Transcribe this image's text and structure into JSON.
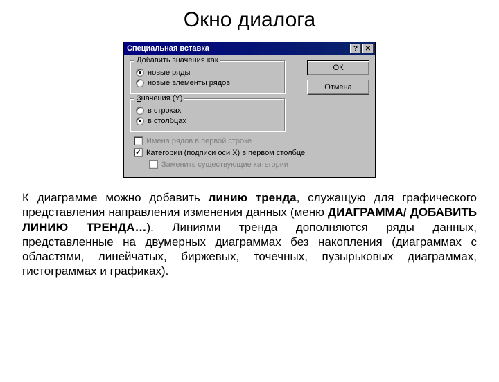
{
  "page": {
    "title": "Окно диалога"
  },
  "dialog": {
    "title": "Специальная вставка",
    "buttons": {
      "ok": "ОК",
      "cancel": "Отмена"
    },
    "group1": {
      "legend": "Добавить значения как",
      "opt1": "новые ряды",
      "opt2": "новые элементы рядов"
    },
    "group2": {
      "legend": "Значения (Y)",
      "opt1": "в строках",
      "opt2": "в столбцах"
    },
    "checks": {
      "c1": "Имена рядов в первой строке",
      "c2": "Категории (подписи оси X) в первом столбце",
      "c3": "Заменить существующие категории"
    }
  },
  "bodytext": {
    "p": "К диаграмме можно добавить линию тренда, служащую для графического представления направления изменения данных (меню ДИАГРАММА/ ДОБАВИТЬ ЛИНИЮ ТРЕНДА…). Линиями тренда дополняются ряды данных, представленные на двумерных диаграммах без накопления (диаграммах с областями, линейчатых, биржевых, точечных, пузырьковых диаграммах, гистограммах и графиках)."
  }
}
